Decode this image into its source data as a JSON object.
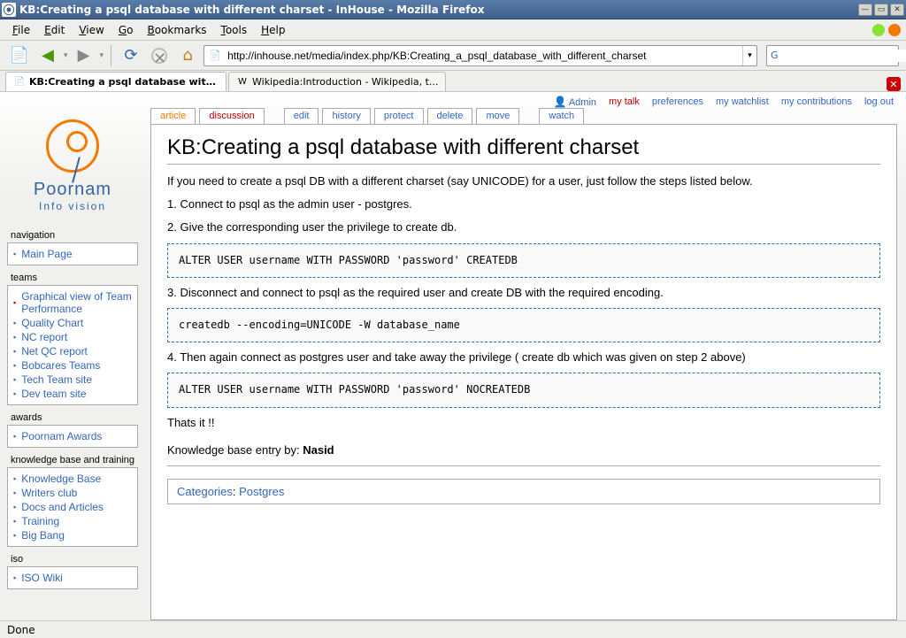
{
  "window": {
    "title": "KB:Creating a psql database with different charset - InHouse - Mozilla Firefox"
  },
  "menubar": {
    "file": "File",
    "edit": "Edit",
    "view": "View",
    "go": "Go",
    "bookmarks": "Bookmarks",
    "tools": "Tools",
    "help": "Help"
  },
  "toolbar": {
    "url": "http://inhouse.net/media/index.php/KB:Creating_a_psql_database_with_different_charset"
  },
  "tabs": [
    {
      "label": "KB:Creating a psql database with..."
    },
    {
      "label": "Wikipedia:Introduction - Wikipedia, t..."
    }
  ],
  "personal": {
    "admin": "Admin",
    "talk": "my talk",
    "prefs": "preferences",
    "watchlist": "my watchlist",
    "contribs": "my contributions",
    "logout": "log out"
  },
  "ca_tabs": {
    "article": "article",
    "discussion": "discussion",
    "edit": "edit",
    "history": "history",
    "protect": "protect",
    "delete": "delete",
    "move": "move",
    "watch": "watch"
  },
  "logo": {
    "line1": "Poornam",
    "line2": "Info vision"
  },
  "portlets": {
    "navigation": {
      "title": "navigation",
      "items": [
        "Main Page"
      ]
    },
    "teams": {
      "title": "teams",
      "items": [
        "Graphical view of Team Performance",
        "Quality Chart",
        "NC report",
        "Net QC report",
        "Bobcares Teams",
        "Tech Team site",
        "Dev team site"
      ]
    },
    "awards": {
      "title": "awards",
      "items": [
        "Poornam Awards"
      ]
    },
    "kb": {
      "title": "knowledge base and training",
      "items": [
        "Knowledge Base",
        "Writers club",
        "Docs and Articles",
        "Training",
        "Big Bang"
      ]
    },
    "iso": {
      "title": "iso",
      "items": [
        "ISO Wiki"
      ]
    }
  },
  "article": {
    "title": "KB:Creating a psql database with different charset",
    "intro": "If you need to create a psql DB with a different charset (say UNICODE) for a user, just follow the steps listed below.",
    "step1": "1. Connect to psql as the admin user - postgres.",
    "step2": "2. Give the corresponding user the privilege to create db.",
    "code1": "ALTER USER username WITH PASSWORD 'password' CREATEDB",
    "step3": "3. Disconnect and connect to psql as the required user and create DB with the required encoding.",
    "code2": "createdb --encoding=UNICODE -W database_name",
    "step4": "4. Then again connect as postgres user and take away the privilege ( create db which was given on step 2 above)",
    "code3": "ALTER USER username WITH PASSWORD 'password' NOCREATEDB",
    "thatsit": "Thats it !!",
    "kb_by_label": "Knowledge base entry by: ",
    "kb_by_name": "Nasid",
    "cat_label": "Categories",
    "cat_sep": ": ",
    "cat_val": "Postgres"
  },
  "status": {
    "text": "Done"
  }
}
